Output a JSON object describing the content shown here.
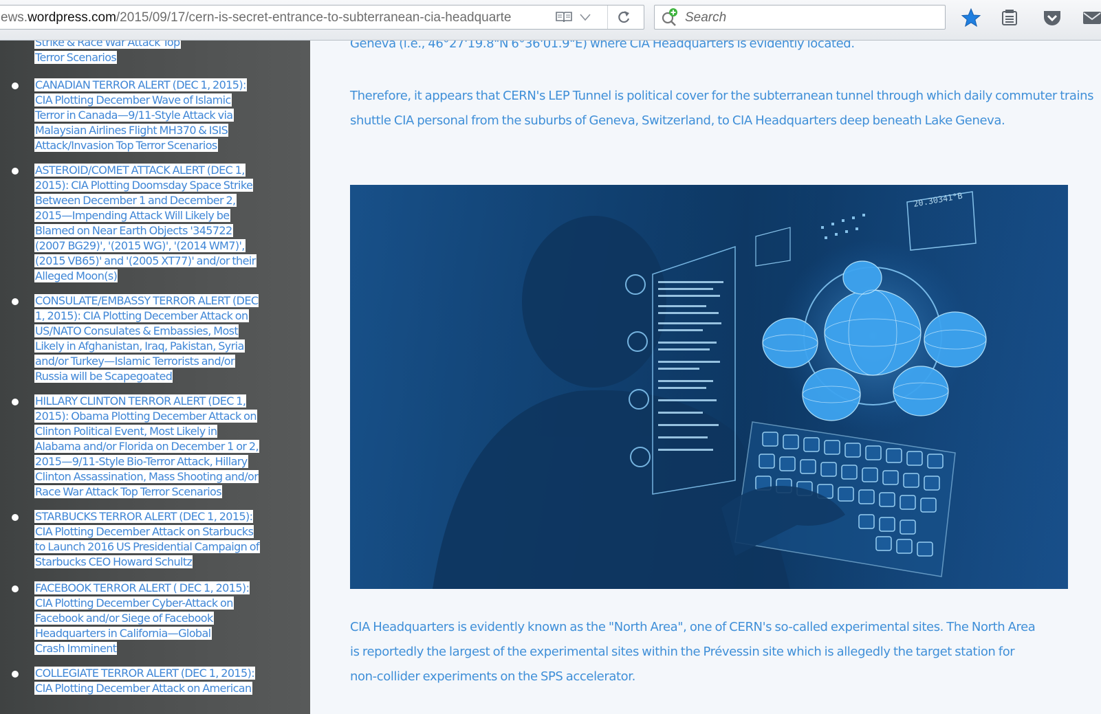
{
  "browser": {
    "url_prefix": "ews.",
    "url_host": "wordpress.com",
    "url_path": "/2015/09/17/cern-is-secret-entrance-to-subterranean-cia-headquarte",
    "search_placeholder": "Search"
  },
  "sidebar": {
    "items": [
      {
        "lines": [
          "Strike & Race War Attack Top",
          "Terror Scenarios"
        ]
      },
      {
        "lines": [
          "CANADIAN TERROR ALERT (DEC 1, 2015):",
          "CIA Plotting December Wave of Islamic",
          "Terror in Canada—9/11-Style Attack via",
          "Malaysian Airlines Flight MH370 & ISIS",
          "Attack/Invasion Top Terror Scenarios"
        ]
      },
      {
        "lines": [
          "ASTEROID/COMET ATTACK ALERT (DEC 1,",
          "2015): CIA Plotting Doomsday Space Strike",
          "Between December 1 and December 2,",
          "2015—Impending Attack Will Likely be",
          "Blamed on Near Earth Objects '345722",
          "(2007 BG29)', '(2015 WG)', '(2014 WM7)',",
          "(2015 VB65)' and '(2005 XT77)' and/or their",
          "Alleged Moon(s)"
        ]
      },
      {
        "lines": [
          "CONSULATE/EMBASSY TERROR ALERT (DEC",
          "1, 2015): CIA Plotting December Attack on",
          "US/NATO Consulates & Embassies, Most",
          "Likely in Afghanistan, Iraq, Pakistan, Syria",
          "and/or Turkey—Islamic Terrorists and/or",
          "Russia will be Scapegoated"
        ]
      },
      {
        "lines": [
          "HILLARY CLINTON TERROR ALERT (DEC 1,",
          "2015): Obama Plotting December Attack on",
          "Clinton Political Event, Most Likely in",
          "Alabama and/or Florida on December 1 or 2,",
          "2015—9/11-Style Bio-Terror Attack, Hillary",
          "Clinton Assassination, Mass Shooting and/or",
          "Race War Attack Top Terror Scenarios"
        ]
      },
      {
        "lines": [
          "STARBUCKS TERROR ALERT (DEC 1, 2015):",
          "CIA Plotting December Attack on Starbucks",
          "to Launch 2016 US Presidential Campaign of",
          "Starbucks CEO Howard Schultz"
        ]
      },
      {
        "lines": [
          "FACEBOOK TERROR ALERT ( DEC 1, 2015):",
          "CIA Plotting December Cyber-Attack on",
          "Facebook and/or Siege of Facebook",
          "Headquarters in California—Global",
          "Crash Imminent"
        ]
      },
      {
        "lines": [
          "COLLEGIATE TERROR ALERT (DEC 1, 2015):",
          "CIA Plotting December Attack on American"
        ]
      }
    ]
  },
  "article": {
    "para_top": "Geneva (i.e., 46°27'19.8\"N 6°36'01.9\"E) where CIA Headquarters is evidently located.",
    "para_tunnel": "Therefore, it appears that CERN's LEP Tunnel is political cover for the subterranean tunnel through which daily commuter trains shuttle CIA personal from the suburbs of Geneva, Switzerland, to CIA Headquarters deep beneath Lake Geneva.",
    "para_northarea": "CIA Headquarters is evidently known as the \"North Area\", one of CERN's so-called experimental sites. The North Area\nis reportedly the largest of the experimental sites within the Prévessin site which is allegedly the target station for\nnon-collider experiments on the SPS accelerator.",
    "image_hud_number": "20.30341°B"
  },
  "colors": {
    "link": "#3f86d6",
    "sidebar_bg": "#4c4e4e",
    "article_text": "#3f8fd8",
    "star": "#1f7fe0"
  },
  "icons": [
    "reader-view-icon",
    "history-dropdown-icon",
    "reload-icon",
    "search-engine-icon",
    "bookmark-star-icon",
    "bookmarks-menu-icon",
    "pocket-icon",
    "mail-icon"
  ]
}
